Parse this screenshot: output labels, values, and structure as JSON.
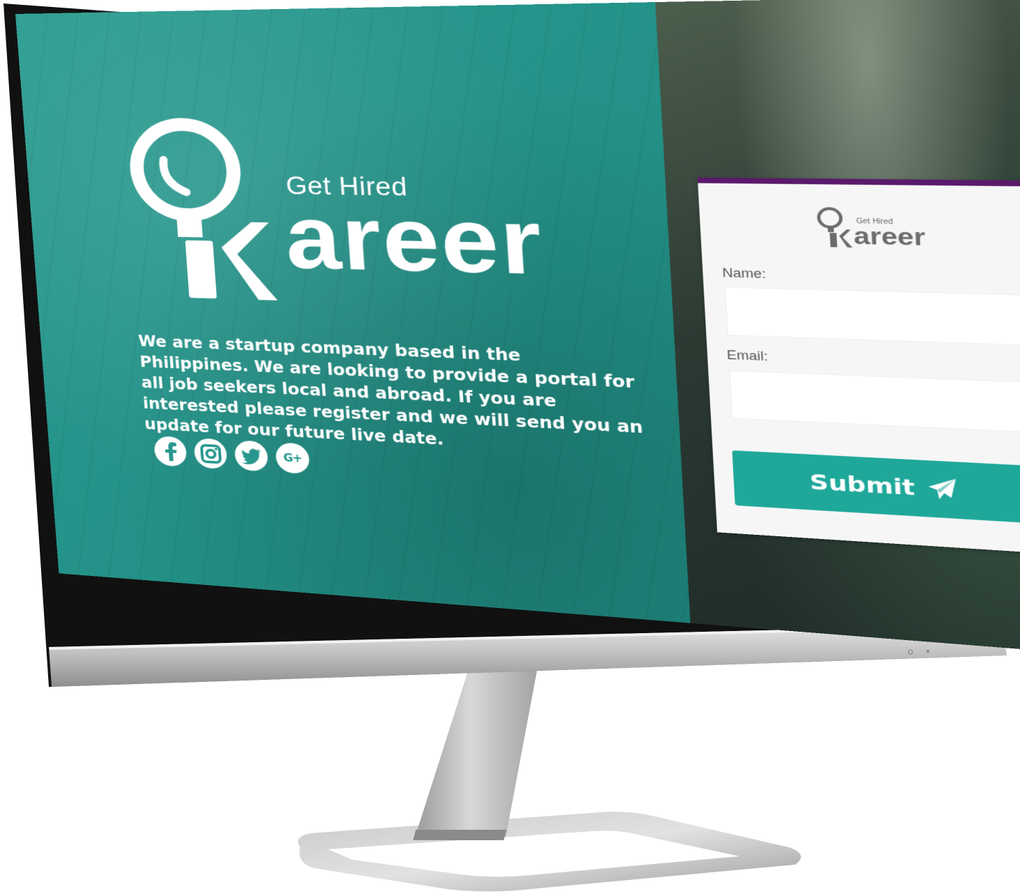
{
  "brand": {
    "tagline": "Get Hired",
    "wordmark": "areer",
    "logo_letter_icon": "magnifier-k-icon"
  },
  "intro": {
    "text": "We are a startup company based in the Philippines. We are looking to provide a portal for all job seekers local and abroad. If you are interested please register and we will send you an update for our future live date."
  },
  "social": {
    "items": [
      {
        "icon": "facebook-icon"
      },
      {
        "icon": "instagram-icon"
      },
      {
        "icon": "twitter-icon"
      },
      {
        "icon": "google-plus-icon",
        "glyph": "G+"
      }
    ]
  },
  "form": {
    "logo_tagline": "Get Hired",
    "logo_wordmark": "areer",
    "name_label": "Name:",
    "name_value": "",
    "email_label": "Email:",
    "email_value": "",
    "submit_label": "Submit",
    "submit_icon": "paper-plane-icon"
  },
  "colors": {
    "teal": "#27978d",
    "button": "#1fa89a",
    "card_accent": "#5a1a6b",
    "card_bg": "#f7f6f7"
  }
}
